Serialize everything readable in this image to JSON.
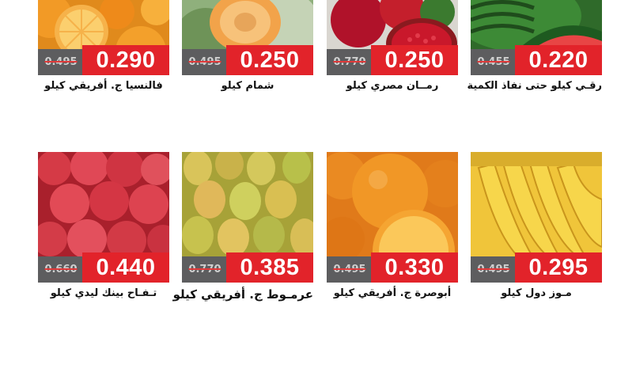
{
  "products": [
    {
      "id": "watermelon",
      "name": "رقـي كيلو حتى نفاذ الكمية",
      "old_price": "0.455",
      "new_price": "0.220",
      "icon": "watermelon-image"
    },
    {
      "id": "pomegranate",
      "name": "رمــان مصري كيلو",
      "old_price": "0.770",
      "new_price": "0.250",
      "icon": "pomegranate-image"
    },
    {
      "id": "melon",
      "name": "شمام كيلو",
      "old_price": "0.495",
      "new_price": "0.250",
      "icon": "melon-image"
    },
    {
      "id": "valencia-orange",
      "name": "فالنسيا ج. أفريقي كيلو",
      "old_price": "0.495",
      "new_price": "0.290",
      "icon": "orange-image"
    },
    {
      "id": "banana",
      "name": "مـوز دول كيلو",
      "old_price": "0.495",
      "new_price": "0.295",
      "icon": "banana-image"
    },
    {
      "id": "navel-orange",
      "name": "أبوصرة ج. أفريقي كيلو",
      "old_price": "0.495",
      "new_price": "0.330",
      "icon": "navel-orange-image"
    },
    {
      "id": "pear",
      "name": "عرمـوط ج. أفريقي كيلو",
      "old_price": "0.770",
      "new_price": "0.385",
      "icon": "pear-image"
    },
    {
      "id": "apple",
      "name": "تـفـاح بينك ليدي كيلو",
      "old_price": "0.660",
      "new_price": "0.440",
      "icon": "apple-image"
    }
  ],
  "colors": {
    "price_red": "#e2232a",
    "old_price_gray": "#5d5d5f"
  }
}
